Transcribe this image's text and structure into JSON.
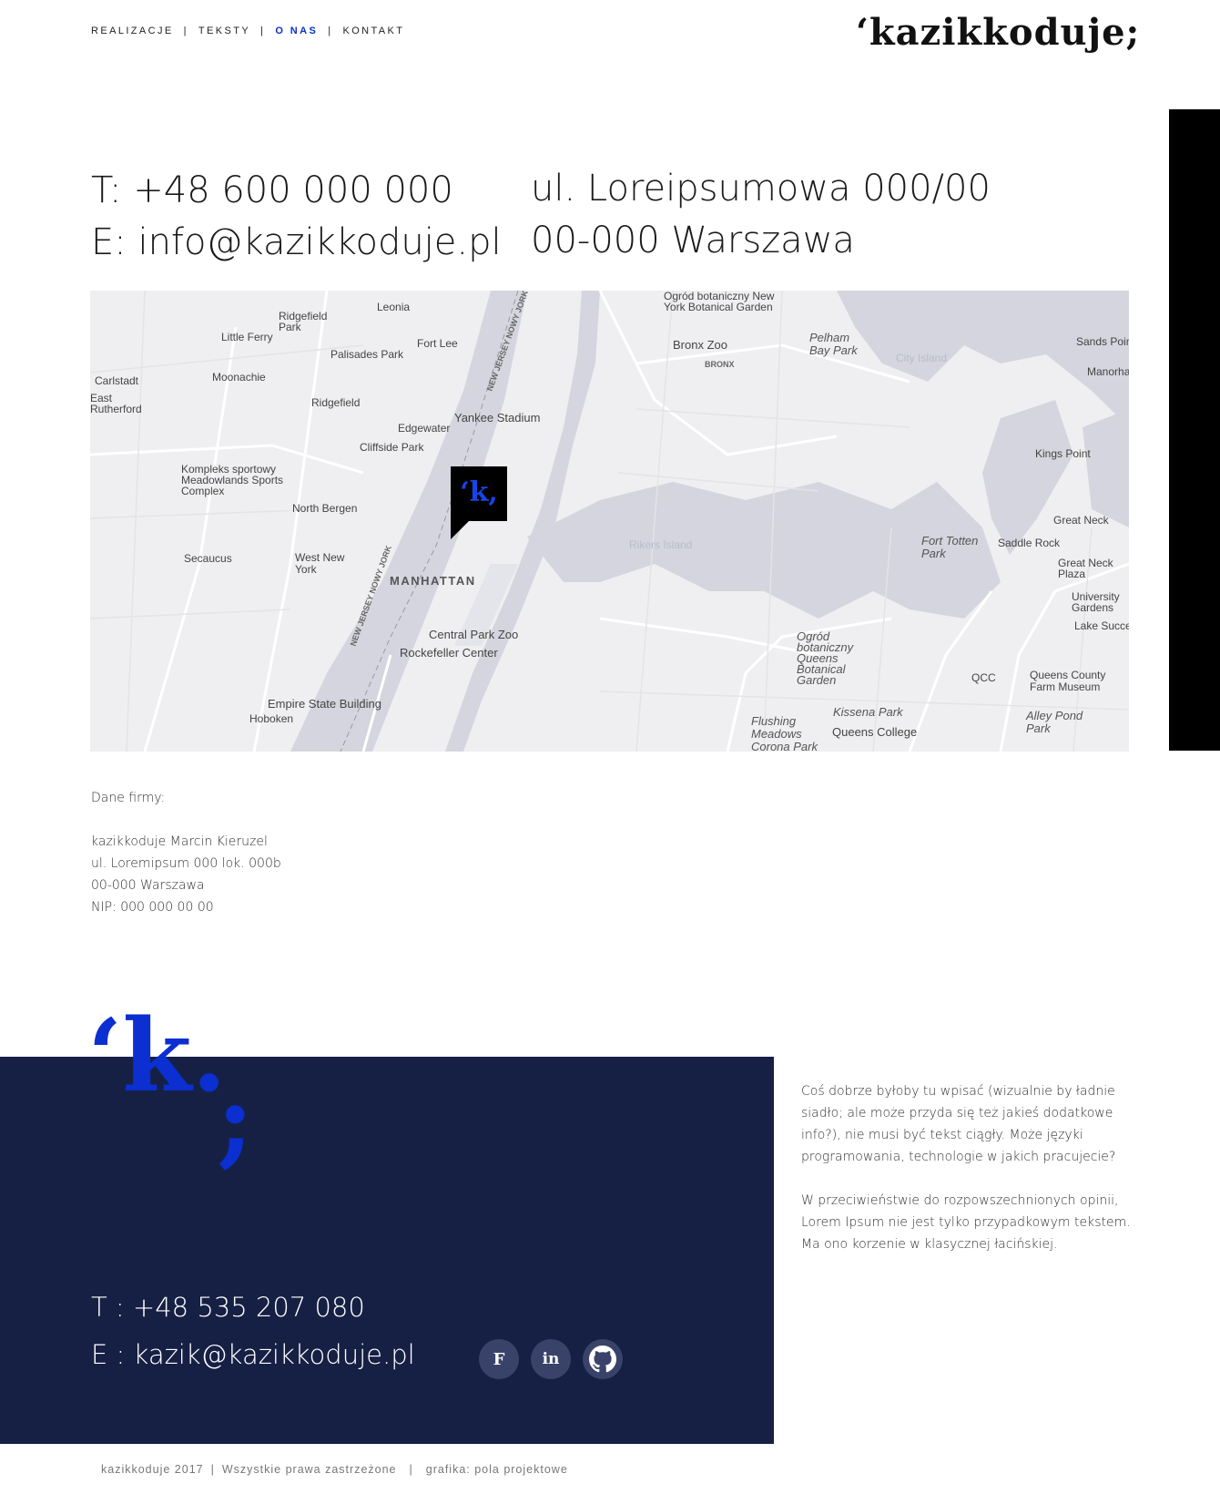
{
  "nav": {
    "items": [
      {
        "label": "REALIZACJE",
        "active": false
      },
      {
        "label": "TEKSTY",
        "active": false
      },
      {
        "label": "O NAS",
        "active": true
      },
      {
        "label": "KONTAKT",
        "active": false
      }
    ],
    "separator": "|"
  },
  "brand": {
    "logo_text": "‘kazikkoduje;"
  },
  "contact": {
    "phone": "T: +48 600 000 000",
    "email": "E: info@kazikkoduje.pl",
    "street": "ul. Loreipsumowa 000/00",
    "city": "00-000 Warszawa"
  },
  "map": {
    "marker_text": "‘k,",
    "labels": {
      "manhattan": "MANHATTAN",
      "north_bergen": "North Bergen",
      "secaucus": "Secaucus",
      "west_new_york": "West New York",
      "hoboken": "Hoboken",
      "leonia": "Leonia",
      "fort_lee": "Fort Lee",
      "palisades_park": "Palisades Park",
      "ridgefield_park": "Ridgefield Park",
      "little_ferry": "Little Ferry",
      "moonachie": "Moonachie",
      "ridgefield": "Ridgefield",
      "edgewater": "Edgewater",
      "cliffside_park": "Cliffside Park",
      "carlstadt": "Carlstadt",
      "east_rutherford": "East Rutherford",
      "meadowlands": "Kompleks sportowy Meadowlands Sports Complex",
      "yankee_stadium": "Yankee Stadium",
      "bronx_zoo": "Bronx Zoo",
      "botanical_garden": "Ogród botaniczny New York Botanical Garden",
      "bronx": "BRONX",
      "pelham_bay": "Pelham Bay Park",
      "sands_point": "Sands Point",
      "manorhaven": "Manorhaven",
      "kings_point": "Kings Point",
      "great_neck": "Great Neck",
      "fort_totten": "Fort Totten Park",
      "saddle_rock": "Saddle Rock",
      "great_neck_plaza": "Great Neck Plaza",
      "university_gardens": "University Gardens",
      "lake_success": "Lake Success",
      "central_park_zoo": "Central Park Zoo",
      "rockefeller": "Rockefeller Center",
      "empire_state": "Empire State Building",
      "queens_botanical": "Ogród botaniczny Queens Botanical Garden",
      "qcc": "QCC",
      "queens_farm": "Queens County Farm Museum",
      "kissena": "Kissena Park",
      "queens_college": "Queens College",
      "flushing": "Flushing Meadows Corona Park",
      "alley_pond": "Alley Pond Park",
      "nj_ny_1": "NEW JERSEY NOWY JORK",
      "nj_ny_2": "NEW JERSEY NOWY JORK",
      "city_island": "City Island",
      "rikers": "Rikers Island"
    }
  },
  "company": {
    "heading": "Dane firmy:",
    "lines": [
      "kazikkoduje Marcin Kieruzel",
      "ul. Loremipsum 000 lok. 000b",
      "00-000 Warszawa",
      "NIP: 000 000 00 00"
    ]
  },
  "footer": {
    "logo_letter": "‘k.",
    "logo_semicolon": ";",
    "phone": "T : +48 535 207 080",
    "email": "E : kazik@kazikkoduje.pl",
    "social": [
      {
        "label": "F",
        "icon": "facebook-icon"
      },
      {
        "label": "in",
        "icon": "linkedin-icon"
      },
      {
        "label": "",
        "icon": "github-icon"
      }
    ],
    "about_p1": "Coś dobrze byłoby tu wpisać (wizualnie by ładnie siadło; ale może przyda się też jakieś dodatkowe info?), nie musi być tekst ciągły. Może języki programowania, technologie w jakich pracujecie?",
    "about_p2": "W przeciwieństwie do rozpowszechnionych opinii, Lorem Ipsum nie jest tylko przypadkowym tekstem. Ma ono korzenie w klasycznej łacińskiej.",
    "copyright": [
      "kazikkoduje 2017",
      "Wszystkie prawa zastrzeżone",
      "grafika: pola projektowe"
    ]
  },
  "colors": {
    "accent": "#0b2fd1",
    "footer_bg": "#162044",
    "social_bg": "#39436a"
  }
}
